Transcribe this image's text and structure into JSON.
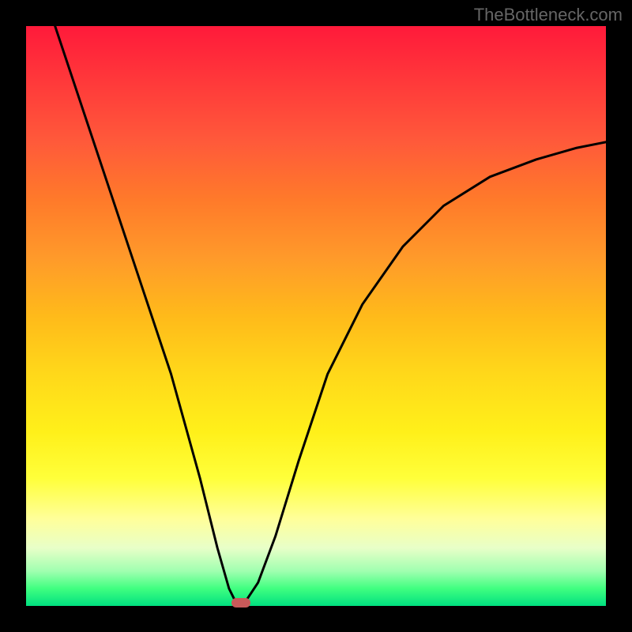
{
  "watermark": "TheBottleneck.com",
  "chart_data": {
    "type": "line",
    "title": "",
    "xlabel": "",
    "ylabel": "",
    "xlim": [
      0,
      100
    ],
    "ylim": [
      0,
      100
    ],
    "series": [
      {
        "name": "bottleneck-curve",
        "x": [
          5,
          10,
          15,
          20,
          25,
          30,
          33,
          35,
          36,
          37,
          38,
          40,
          43,
          47,
          52,
          58,
          65,
          72,
          80,
          88,
          95,
          100
        ],
        "y": [
          100,
          85,
          70,
          55,
          40,
          22,
          10,
          3,
          1,
          0,
          1,
          4,
          12,
          25,
          40,
          52,
          62,
          69,
          74,
          77,
          79,
          80
        ]
      }
    ],
    "marker": {
      "x": 37,
      "y": 0.5,
      "color": "#c85a5a"
    },
    "background_gradient": {
      "top": "#ff1a3a",
      "upper_mid": "#ff9a2a",
      "mid": "#ffd81a",
      "lower_mid": "#ffff3a",
      "bottom": "#00e080"
    }
  }
}
